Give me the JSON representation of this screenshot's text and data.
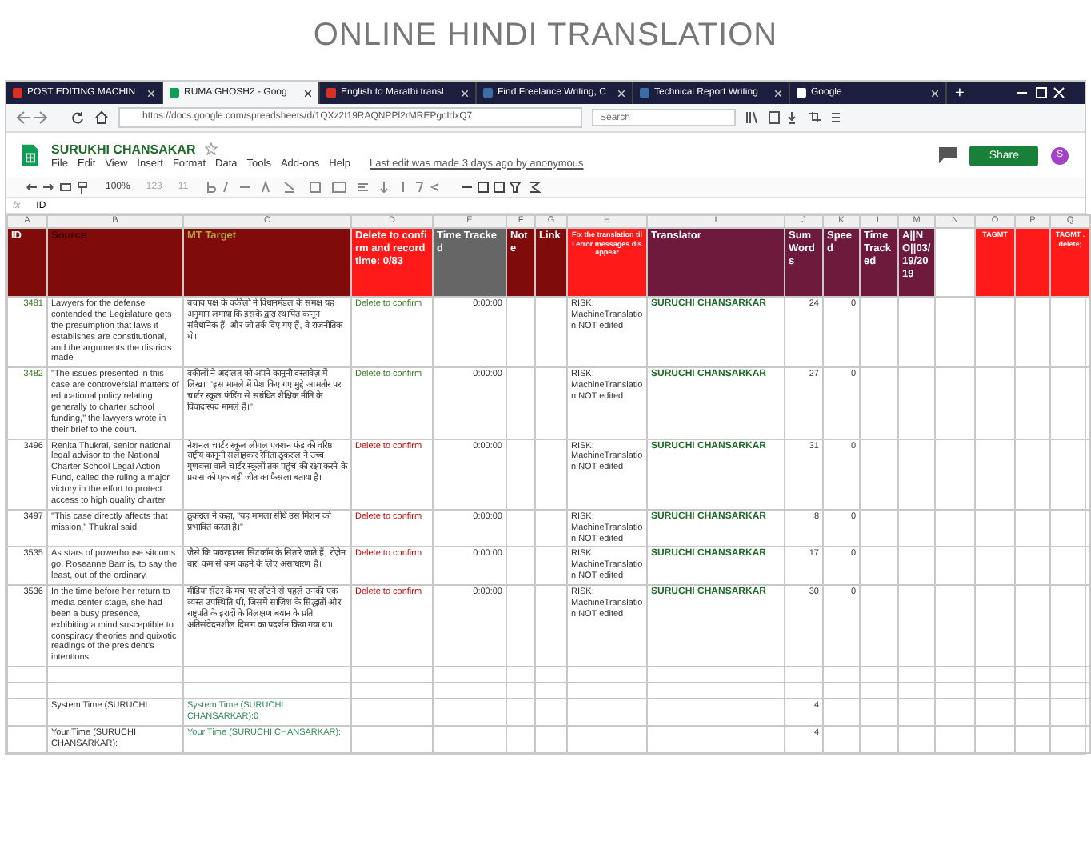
{
  "page_title": "ONLINE HINDI TRANSLATION",
  "browser": {
    "tabs": [
      {
        "label": "POST EDITING MACHIN",
        "kind": "mail",
        "selected": false
      },
      {
        "label": "RUMA GHOSH2 - Goog",
        "kind": "sheet",
        "selected": true
      },
      {
        "label": "English to Marathi transl",
        "kind": "mail",
        "selected": false
      },
      {
        "label": "Find Freelance Writing, C",
        "kind": "site",
        "selected": false
      },
      {
        "label": "Technical Report Writing",
        "kind": "site",
        "selected": false
      },
      {
        "label": "Google",
        "kind": "google",
        "selected": false
      }
    ],
    "new_tab": "+",
    "url": "https://docs.google.com/spreadsheets/d/1QXz2I19RAQNPPl2rMREPgcIdxQ7",
    "search_placeholder": "Search"
  },
  "sheets": {
    "doc_title": "SURUKHI CHANSAKAR",
    "menu": [
      "File",
      "Edit",
      "View",
      "Insert",
      "Format",
      "Data",
      "Tools",
      "Add-ons",
      "Help"
    ],
    "last_edit": "Last edit was made 3 days ago by anonymous",
    "share": "Share",
    "avatar": "S",
    "zoom": "100%",
    "number_format": "123",
    "font_size": "11",
    "formula_label": "fx",
    "formula_value": "ID"
  },
  "columns": [
    "A",
    "B",
    "C",
    "D",
    "E",
    "F",
    "G",
    "H",
    "I",
    "J",
    "K",
    "L",
    "M",
    "N",
    "O",
    "P",
    "Q"
  ],
  "header": [
    {
      "text": "ID",
      "color": "#7f0b0b"
    },
    {
      "text": "Source",
      "color": "#7f0b0b"
    },
    {
      "text": "MT Target",
      "color": "#7f0b0b"
    },
    {
      "text": "Delete to confirm and record time: 0/83",
      "color": "#ff1a1a"
    },
    {
      "text": "Time Tracked",
      "color": "#666666"
    },
    {
      "text": "Note",
      "color": "#7f0b0b"
    },
    {
      "text": "Link",
      "color": "#7f0b0b"
    },
    {
      "text": "Fix the translation till error messages disappear",
      "color": "#ff1a1a"
    },
    {
      "text": "Translator",
      "color": "#6e1a3c"
    },
    {
      "text": "SumWords",
      "color": "#6e1a3c"
    },
    {
      "text": "Speed",
      "color": "#6e1a3c"
    },
    {
      "text": "Time Tracked",
      "color": "#6e1a3c"
    },
    {
      "text": "A||NO||03/19/2019",
      "color": "#6e1a3c"
    },
    {
      "color": "#ffffff"
    },
    {
      "text": "TAGMT",
      "color": "#ff1a1a"
    },
    {
      "color": "#ff1a1a"
    },
    {
      "text": "TAGMT .delete;",
      "color": "#ff1a1a"
    }
  ],
  "rows": [
    {
      "id": {
        "text": "3481",
        "color": "#38761d"
      },
      "source": "Lawyers for the defense contended the Legislature gets the presumption that laws it establishes are constitutional, and the arguments the districts made",
      "target": "बचाव पक्ष के वकीलों ने विधानमंडल के समक्ष यह अनुमान लगाया कि इसके द्वारा स्थापित कानून संवैधानिक हैं, और जो तर्क दिए गए हैं, वे राजनीतिक थे।",
      "delete": {
        "text": "Delete to confirm",
        "color": "#38761d"
      },
      "time": "0:00:00",
      "risk": "RISK: MachineTranslation NOT edited",
      "translator": "SURUCHI CHANSARKAR",
      "words": "24",
      "speed": "0"
    },
    {
      "id": {
        "text": "3482",
        "color": "#38761d"
      },
      "source": "\"The issues presented in this case are controversial matters of educational policy relating generally to charter school funding,\" the lawyers wrote in their brief to the court.",
      "target": "वकीलों ने अदालत को अपने कानूनी दस्तावेज़ में लिखा, \"इस मामले में पेश किए गए मुद्दे आमतौर पर चार्टर स्कूल फंडिंग से संबंधित शैक्षिक नीति के विवादास्पद मामले हैं।\"",
      "delete": {
        "text": "Delete to confirm",
        "color": "#38761d"
      },
      "time": "0:00:00",
      "risk": "RISK: MachineTranslation NOT edited",
      "translator": "SURUCHI CHANSARKAR",
      "words": "27",
      "speed": "0"
    },
    {
      "id": {
        "text": "3496",
        "color": "#333333"
      },
      "source": "Renita Thukral, senior national legal advisor to the National Charter School Legal Action Fund, called the ruling a major victory in the effort to protect access to high quality charter",
      "target": "नेशनल चार्टर स्कूल लीगल एक्शन फंड की वरिष्ठ राष्ट्रीय कानूनी सलाहकार रेनिता ठुकराल ने उच्च गुणवत्ता वाले चार्टर स्कूलों तक पहुंच की रक्षा करने के प्रयास को एक बड़ी जीत का फैसला बताया है।",
      "delete": {
        "text": "Delete to confirm",
        "color": "#cc0000"
      },
      "time": "0:00:00",
      "risk": "RISK: MachineTranslation NOT edited",
      "translator": "SURUCHI CHANSARKAR",
      "words": "31",
      "speed": "0"
    },
    {
      "id": {
        "text": "3497",
        "color": "#333333"
      },
      "source": "\"This case directly affects that mission,\" Thukral said.",
      "target": "ठुकराल ने कहा, \"यह मामला सीधे उस मिशन को प्रभावित करता है।\"",
      "delete": {
        "text": "Delete to confirm",
        "color": "#cc0000"
      },
      "time": "0:00:00",
      "risk": "RISK: MachineTranslation NOT edited",
      "translator": "SURUCHI CHANSARKAR",
      "words": "8",
      "speed": "0"
    },
    {
      "id": {
        "text": "3535",
        "color": "#333333"
      },
      "source": "As stars of powerhouse sitcoms go, Roseanne Barr is, to say the least, out of the ordinary.",
      "target": "जैसे कि पावरहाउस सिटकॉम के सितारे जाते हैं, रोज़ेन बार, कम से कम कहने के लिए असाधारण है।",
      "delete": {
        "text": "Delete to confirm",
        "color": "#cc0000"
      },
      "time": "0:00:00",
      "risk": "RISK: MachineTranslation NOT edited",
      "translator": "SURUCHI CHANSARKAR",
      "words": "17",
      "speed": "0"
    },
    {
      "id": {
        "text": "3536",
        "color": "#333333"
      },
      "source": "In the time before her return to media center stage, she had been a busy presence, exhibiting a mind susceptible to conspiracy theories and quixotic readings of the president's intentions.",
      "target": "मीडिया सेंटर के मंच पर लौटने से पहले उनकी एक व्यस्त उपस्थिति थी, जिसमें साजिश के सिद्धांतों और राष्ट्रपति के इरादों के विलक्षण बयान के प्रति अतिसंवेदनशील दिमाग का प्रदर्शन किया गया था।",
      "delete": {
        "text": "Delete to confirm",
        "color": "#cc0000"
      },
      "time": "0:00:00",
      "risk": "RISK: MachineTranslation NOT edited",
      "translator": "SURUCHI CHANSARKAR",
      "words": "30",
      "speed": "0"
    }
  ],
  "footer_rows": [
    {},
    {},
    {
      "source": "System Time (SURUCHI",
      "target": "System Time (SURUCHI CHANSARKAR):0",
      "words": "4"
    },
    {
      "source": "Your Time (SURUCHI CHANSARKAR):",
      "target": "Your Time (SURUCHI CHANSARKAR):",
      "words": "4"
    }
  ]
}
